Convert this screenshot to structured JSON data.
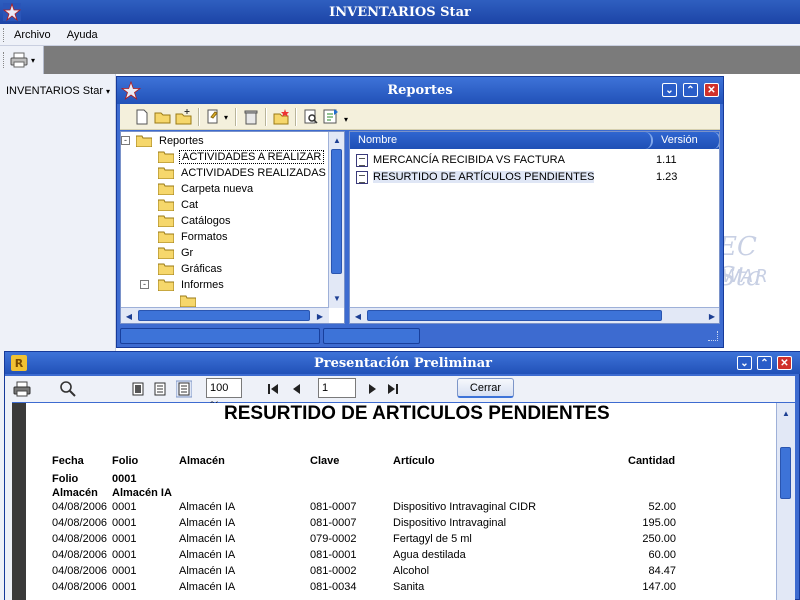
{
  "app": {
    "title": "INVENTARIOS Star"
  },
  "menubar": {
    "items": [
      {
        "label": "Archivo"
      },
      {
        "label": "Ayuda"
      }
    ]
  },
  "side_panel": {
    "label": "INVENTARIOS Star"
  },
  "watermark": {
    "line1": "EC Sta",
    "line2": "WAR"
  },
  "reportes": {
    "title": "Reportes",
    "tree": {
      "root": "Reportes",
      "items": [
        {
          "label": "ACTIVIDADES A REALIZAR"
        },
        {
          "label": "ACTIVIDADES REALIZADAS"
        },
        {
          "label": "Carpeta nueva"
        },
        {
          "label": "Cat"
        },
        {
          "label": "Catálogos"
        },
        {
          "label": "Formatos"
        },
        {
          "label": "Gr"
        },
        {
          "label": "Gráficas"
        },
        {
          "label": "Informes"
        }
      ]
    },
    "list": {
      "columns": {
        "name": "Nombre",
        "version": "Versión"
      },
      "rows": [
        {
          "name": "MERCANCÍA RECIBIDA VS FACTURA",
          "version": "1.11"
        },
        {
          "name": "RESURTIDO DE ARTÍCULOS PENDIENTES",
          "version": "1.23"
        }
      ]
    }
  },
  "preview": {
    "title": "Presentación Preliminar",
    "zoom": "100 %",
    "page": "1",
    "close_label": "Cerrar"
  },
  "report": {
    "title": "RESURTIDO DE ARTICULOS PENDIENTES",
    "headers": {
      "fecha": "Fecha",
      "folio": "Folio",
      "almacen": "Almacén",
      "clave": "Clave",
      "articulo": "Artículo",
      "cantidad": "Cantidad"
    },
    "group": {
      "folio_label": "Folio",
      "folio_value": "0001",
      "almacen_label": "Almacén",
      "almacen_value": "Almacén IA"
    },
    "rows": [
      {
        "fecha": "04/08/2006",
        "folio": "0001",
        "almacen": "Almacén IA",
        "clave": "081-0007",
        "articulo": "Dispositivo Intravaginal CIDR",
        "cantidad": "52.00"
      },
      {
        "fecha": "04/08/2006",
        "folio": "0001",
        "almacen": "Almacén IA",
        "clave": "081-0007",
        "articulo": "Dispositivo Intravaginal",
        "cantidad": "195.00"
      },
      {
        "fecha": "04/08/2006",
        "folio": "0001",
        "almacen": "Almacén IA",
        "clave": "079-0002",
        "articulo": "Fertagyl de 5 ml",
        "cantidad": "250.00"
      },
      {
        "fecha": "04/08/2006",
        "folio": "0001",
        "almacen": "Almacén IA",
        "clave": "081-0001",
        "articulo": "Agua destilada",
        "cantidad": "60.00"
      },
      {
        "fecha": "04/08/2006",
        "folio": "0001",
        "almacen": "Almacén IA",
        "clave": "081-0002",
        "articulo": "Alcohol",
        "cantidad": "84.47"
      },
      {
        "fecha": "04/08/2006",
        "folio": "0001",
        "almacen": "Almacén IA",
        "clave": "081-0034",
        "articulo": "Sanita",
        "cantidad": "147.00"
      }
    ]
  },
  "colors": {
    "titlebar": "#1c44a6",
    "window_frame": "#3d6bd0",
    "close_button": "#d0312b",
    "toolbar_bg": "#f4f0dc"
  }
}
